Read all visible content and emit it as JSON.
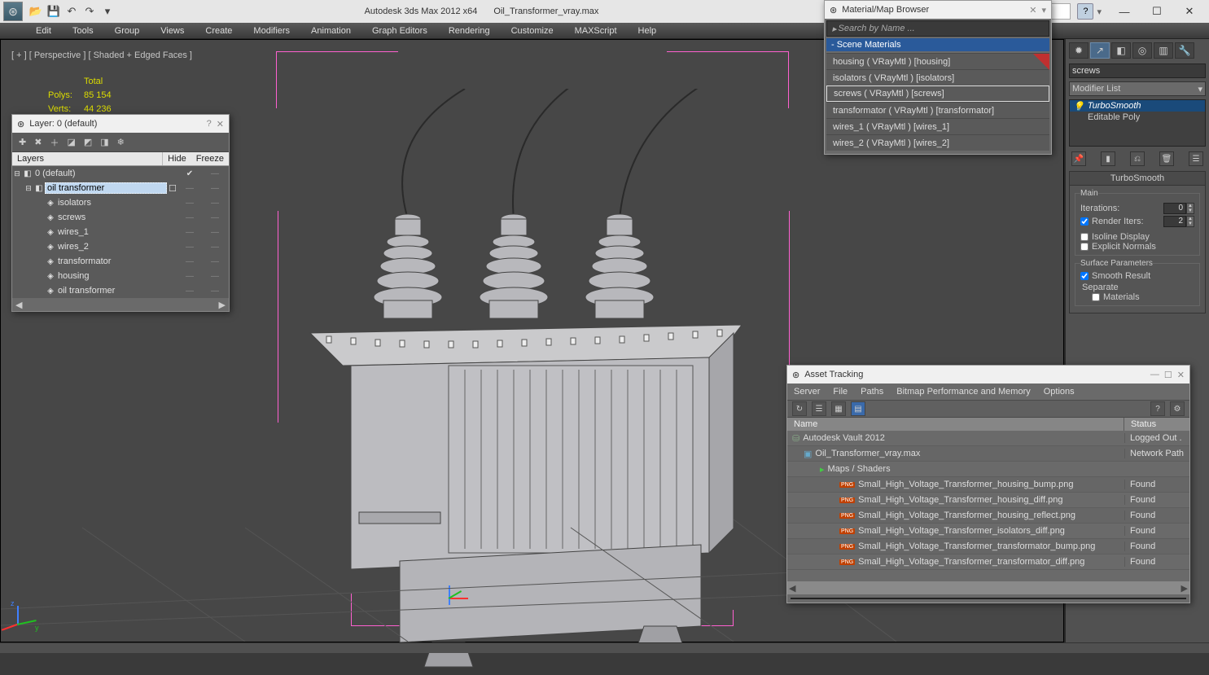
{
  "app": {
    "title": "Autodesk 3ds Max  2012 x64",
    "file": "Oil_Transformer_vray.max"
  },
  "menubar": [
    "Edit",
    "Tools",
    "Group",
    "Views",
    "Create",
    "Modifiers",
    "Animation",
    "Graph Editors",
    "Rendering",
    "Customize",
    "MAXScript",
    "Help"
  ],
  "viewport": {
    "label": "[ + ]  [ Perspective ]  [ Shaded + Edged Faces ]",
    "stats": {
      "total_label": "Total",
      "polys_label": "Polys:",
      "polys": "85 154",
      "verts_label": "Verts:",
      "verts": "44 236"
    }
  },
  "layer_panel": {
    "title": "Layer: 0 (default)",
    "columns": {
      "layers": "Layers",
      "hide": "Hide",
      "freeze": "Freeze"
    },
    "rows": [
      {
        "name": "0 (default)",
        "level": 0,
        "type": "layer",
        "checked": true,
        "expanded": true
      },
      {
        "name": "oil transformer",
        "level": 1,
        "type": "layer",
        "expanded": true,
        "selected": true,
        "box": true
      },
      {
        "name": "isolators",
        "level": 2,
        "type": "obj"
      },
      {
        "name": "screws",
        "level": 2,
        "type": "obj"
      },
      {
        "name": "wires_1",
        "level": 2,
        "type": "obj"
      },
      {
        "name": "wires_2",
        "level": 2,
        "type": "obj"
      },
      {
        "name": "transformator",
        "level": 2,
        "type": "obj"
      },
      {
        "name": "housing",
        "level": 2,
        "type": "obj"
      },
      {
        "name": "oil transformer",
        "level": 2,
        "type": "obj"
      }
    ]
  },
  "material_browser": {
    "title": "Material/Map Browser",
    "search_placeholder": "Search by Name ...",
    "category": "- Scene Materials",
    "items": [
      "housing  ( VRayMtl )  [housing]",
      "isolators  ( VRayMtl )  [isolators]",
      "screws  ( VRayMtl )  [screws]",
      "transformator  ( VRayMtl )  [transformator]",
      "wires_1  ( VRayMtl )  [wires_1]",
      "wires_2  ( VRayMtl )  [wires_2]"
    ],
    "selected_index": 2
  },
  "command_panel": {
    "object_name": "screws",
    "combo": "Modifier List",
    "stack": [
      {
        "name": "TurboSmooth",
        "selected": true
      },
      {
        "name": "Editable Poly"
      }
    ],
    "rollout_title": "TurboSmooth",
    "main_label": "Main",
    "iterations_label": "Iterations:",
    "iterations": "0",
    "render_iters_label": "Render Iters:",
    "render_iters": "2",
    "render_iters_checked": true,
    "isoline_label": "Isoline Display",
    "explicit_label": "Explicit Normals",
    "surface_label": "Surface Parameters",
    "smooth_result_label": "Smooth Result",
    "smooth_result_checked": true,
    "separate_label": "Separate",
    "materials_label": "Materials"
  },
  "asset_tracking": {
    "title": "Asset Tracking",
    "menu": [
      "Server",
      "File",
      "Paths",
      "Bitmap Performance and Memory",
      "Options"
    ],
    "columns": {
      "name": "Name",
      "status": "Status"
    },
    "rows": [
      {
        "name": "Autodesk Vault 2012",
        "status": "Logged Out .",
        "level": 0,
        "icon": "vault"
      },
      {
        "name": "Oil_Transformer_vray.max",
        "status": "Network Path",
        "level": 1,
        "icon": "max"
      },
      {
        "name": "Maps / Shaders",
        "status": "",
        "level": 2,
        "icon": "folder"
      },
      {
        "name": "Small_High_Voltage_Transformer_housing_bump.png",
        "status": "Found",
        "level": 3,
        "icon": "png"
      },
      {
        "name": "Small_High_Voltage_Transformer_housing_diff.png",
        "status": "Found",
        "level": 3,
        "icon": "png"
      },
      {
        "name": "Small_High_Voltage_Transformer_housing_reflect.png",
        "status": "Found",
        "level": 3,
        "icon": "png"
      },
      {
        "name": "Small_High_Voltage_Transformer_isolators_diff.png",
        "status": "Found",
        "level": 3,
        "icon": "png"
      },
      {
        "name": "Small_High_Voltage_Transformer_transformator_bump.png",
        "status": "Found",
        "level": 3,
        "icon": "png"
      },
      {
        "name": "Small_High_Voltage_Transformer_transformator_diff.png",
        "status": "Found",
        "level": 3,
        "icon": "png"
      }
    ]
  }
}
